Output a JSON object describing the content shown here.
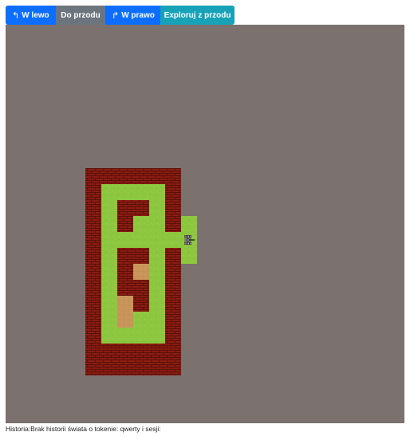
{
  "toolbar": {
    "left_icon": "turn-left-icon",
    "left_label": "W lewo",
    "forward_label": "Do przodu",
    "right_icon": "turn-right-icon",
    "right_label": "W prawo",
    "explore_label": "Exploruj z przodu"
  },
  "board": {
    "background_color": "#7b716f",
    "colors": {
      "brick": "#8b1c12",
      "grass": "#8dc63f",
      "sand": "#c9945a"
    },
    "cols": 25,
    "rows": 25,
    "tiles": [
      {
        "col": 5,
        "row": 9,
        "type": "brick"
      },
      {
        "col": 6,
        "row": 9,
        "type": "brick"
      },
      {
        "col": 7,
        "row": 9,
        "type": "brick"
      },
      {
        "col": 8,
        "row": 9,
        "type": "brick"
      },
      {
        "col": 9,
        "row": 9,
        "type": "brick"
      },
      {
        "col": 10,
        "row": 9,
        "type": "brick"
      },
      {
        "col": 5,
        "row": 10,
        "type": "brick"
      },
      {
        "col": 6,
        "row": 10,
        "type": "grass"
      },
      {
        "col": 7,
        "row": 10,
        "type": "grass"
      },
      {
        "col": 8,
        "row": 10,
        "type": "grass"
      },
      {
        "col": 9,
        "row": 10,
        "type": "grass"
      },
      {
        "col": 10,
        "row": 10,
        "type": "brick"
      },
      {
        "col": 5,
        "row": 11,
        "type": "brick"
      },
      {
        "col": 6,
        "row": 11,
        "type": "grass"
      },
      {
        "col": 7,
        "row": 11,
        "type": "brick"
      },
      {
        "col": 8,
        "row": 11,
        "type": "brick"
      },
      {
        "col": 9,
        "row": 11,
        "type": "grass"
      },
      {
        "col": 10,
        "row": 11,
        "type": "brick"
      },
      {
        "col": 5,
        "row": 12,
        "type": "brick"
      },
      {
        "col": 6,
        "row": 12,
        "type": "grass"
      },
      {
        "col": 7,
        "row": 12,
        "type": "brick"
      },
      {
        "col": 8,
        "row": 12,
        "type": "grass"
      },
      {
        "col": 9,
        "row": 12,
        "type": "grass"
      },
      {
        "col": 10,
        "row": 12,
        "type": "brick"
      },
      {
        "col": 11,
        "row": 12,
        "type": "grass"
      },
      {
        "col": 5,
        "row": 13,
        "type": "brick"
      },
      {
        "col": 6,
        "row": 13,
        "type": "grass"
      },
      {
        "col": 7,
        "row": 13,
        "type": "grass"
      },
      {
        "col": 8,
        "row": 13,
        "type": "grass"
      },
      {
        "col": 9,
        "row": 13,
        "type": "grass"
      },
      {
        "col": 10,
        "row": 13,
        "type": "grass"
      },
      {
        "col": 11,
        "row": 13,
        "type": "grass"
      },
      {
        "col": 5,
        "row": 14,
        "type": "brick"
      },
      {
        "col": 6,
        "row": 14,
        "type": "grass"
      },
      {
        "col": 7,
        "row": 14,
        "type": "brick"
      },
      {
        "col": 8,
        "row": 14,
        "type": "brick"
      },
      {
        "col": 9,
        "row": 14,
        "type": "grass"
      },
      {
        "col": 10,
        "row": 14,
        "type": "brick"
      },
      {
        "col": 11,
        "row": 14,
        "type": "grass"
      },
      {
        "col": 5,
        "row": 15,
        "type": "brick"
      },
      {
        "col": 6,
        "row": 15,
        "type": "grass"
      },
      {
        "col": 7,
        "row": 15,
        "type": "brick"
      },
      {
        "col": 8,
        "row": 15,
        "type": "sand"
      },
      {
        "col": 9,
        "row": 15,
        "type": "grass"
      },
      {
        "col": 10,
        "row": 15,
        "type": "brick"
      },
      {
        "col": 5,
        "row": 16,
        "type": "brick"
      },
      {
        "col": 6,
        "row": 16,
        "type": "grass"
      },
      {
        "col": 7,
        "row": 16,
        "type": "brick"
      },
      {
        "col": 8,
        "row": 16,
        "type": "brick"
      },
      {
        "col": 9,
        "row": 16,
        "type": "grass"
      },
      {
        "col": 10,
        "row": 16,
        "type": "brick"
      },
      {
        "col": 5,
        "row": 17,
        "type": "brick"
      },
      {
        "col": 6,
        "row": 17,
        "type": "grass"
      },
      {
        "col": 7,
        "row": 17,
        "type": "sand"
      },
      {
        "col": 8,
        "row": 17,
        "type": "brick"
      },
      {
        "col": 9,
        "row": 17,
        "type": "grass"
      },
      {
        "col": 10,
        "row": 17,
        "type": "brick"
      },
      {
        "col": 5,
        "row": 18,
        "type": "brick"
      },
      {
        "col": 6,
        "row": 18,
        "type": "grass"
      },
      {
        "col": 7,
        "row": 18,
        "type": "sand"
      },
      {
        "col": 8,
        "row": 18,
        "type": "grass"
      },
      {
        "col": 9,
        "row": 18,
        "type": "grass"
      },
      {
        "col": 10,
        "row": 18,
        "type": "brick"
      },
      {
        "col": 5,
        "row": 19,
        "type": "brick"
      },
      {
        "col": 6,
        "row": 19,
        "type": "grass"
      },
      {
        "col": 7,
        "row": 19,
        "type": "grass"
      },
      {
        "col": 8,
        "row": 19,
        "type": "grass"
      },
      {
        "col": 9,
        "row": 19,
        "type": "grass"
      },
      {
        "col": 10,
        "row": 19,
        "type": "brick"
      },
      {
        "col": 5,
        "row": 20,
        "type": "brick"
      },
      {
        "col": 6,
        "row": 20,
        "type": "brick"
      },
      {
        "col": 7,
        "row": 20,
        "type": "brick"
      },
      {
        "col": 8,
        "row": 20,
        "type": "brick"
      },
      {
        "col": 9,
        "row": 20,
        "type": "brick"
      },
      {
        "col": 10,
        "row": 20,
        "type": "brick"
      },
      {
        "col": 5,
        "row": 21,
        "type": "brick"
      },
      {
        "col": 6,
        "row": 21,
        "type": "brick"
      },
      {
        "col": 7,
        "row": 21,
        "type": "brick"
      },
      {
        "col": 8,
        "row": 21,
        "type": "brick"
      },
      {
        "col": 9,
        "row": 21,
        "type": "brick"
      },
      {
        "col": 10,
        "row": 21,
        "type": "brick"
      }
    ],
    "tank": {
      "col": 11,
      "row": 13,
      "facing": "east",
      "icon": "tank-icon"
    }
  },
  "history": {
    "text": "Historia:Brak historii świata o tokenie: qwerty i sesji:"
  }
}
